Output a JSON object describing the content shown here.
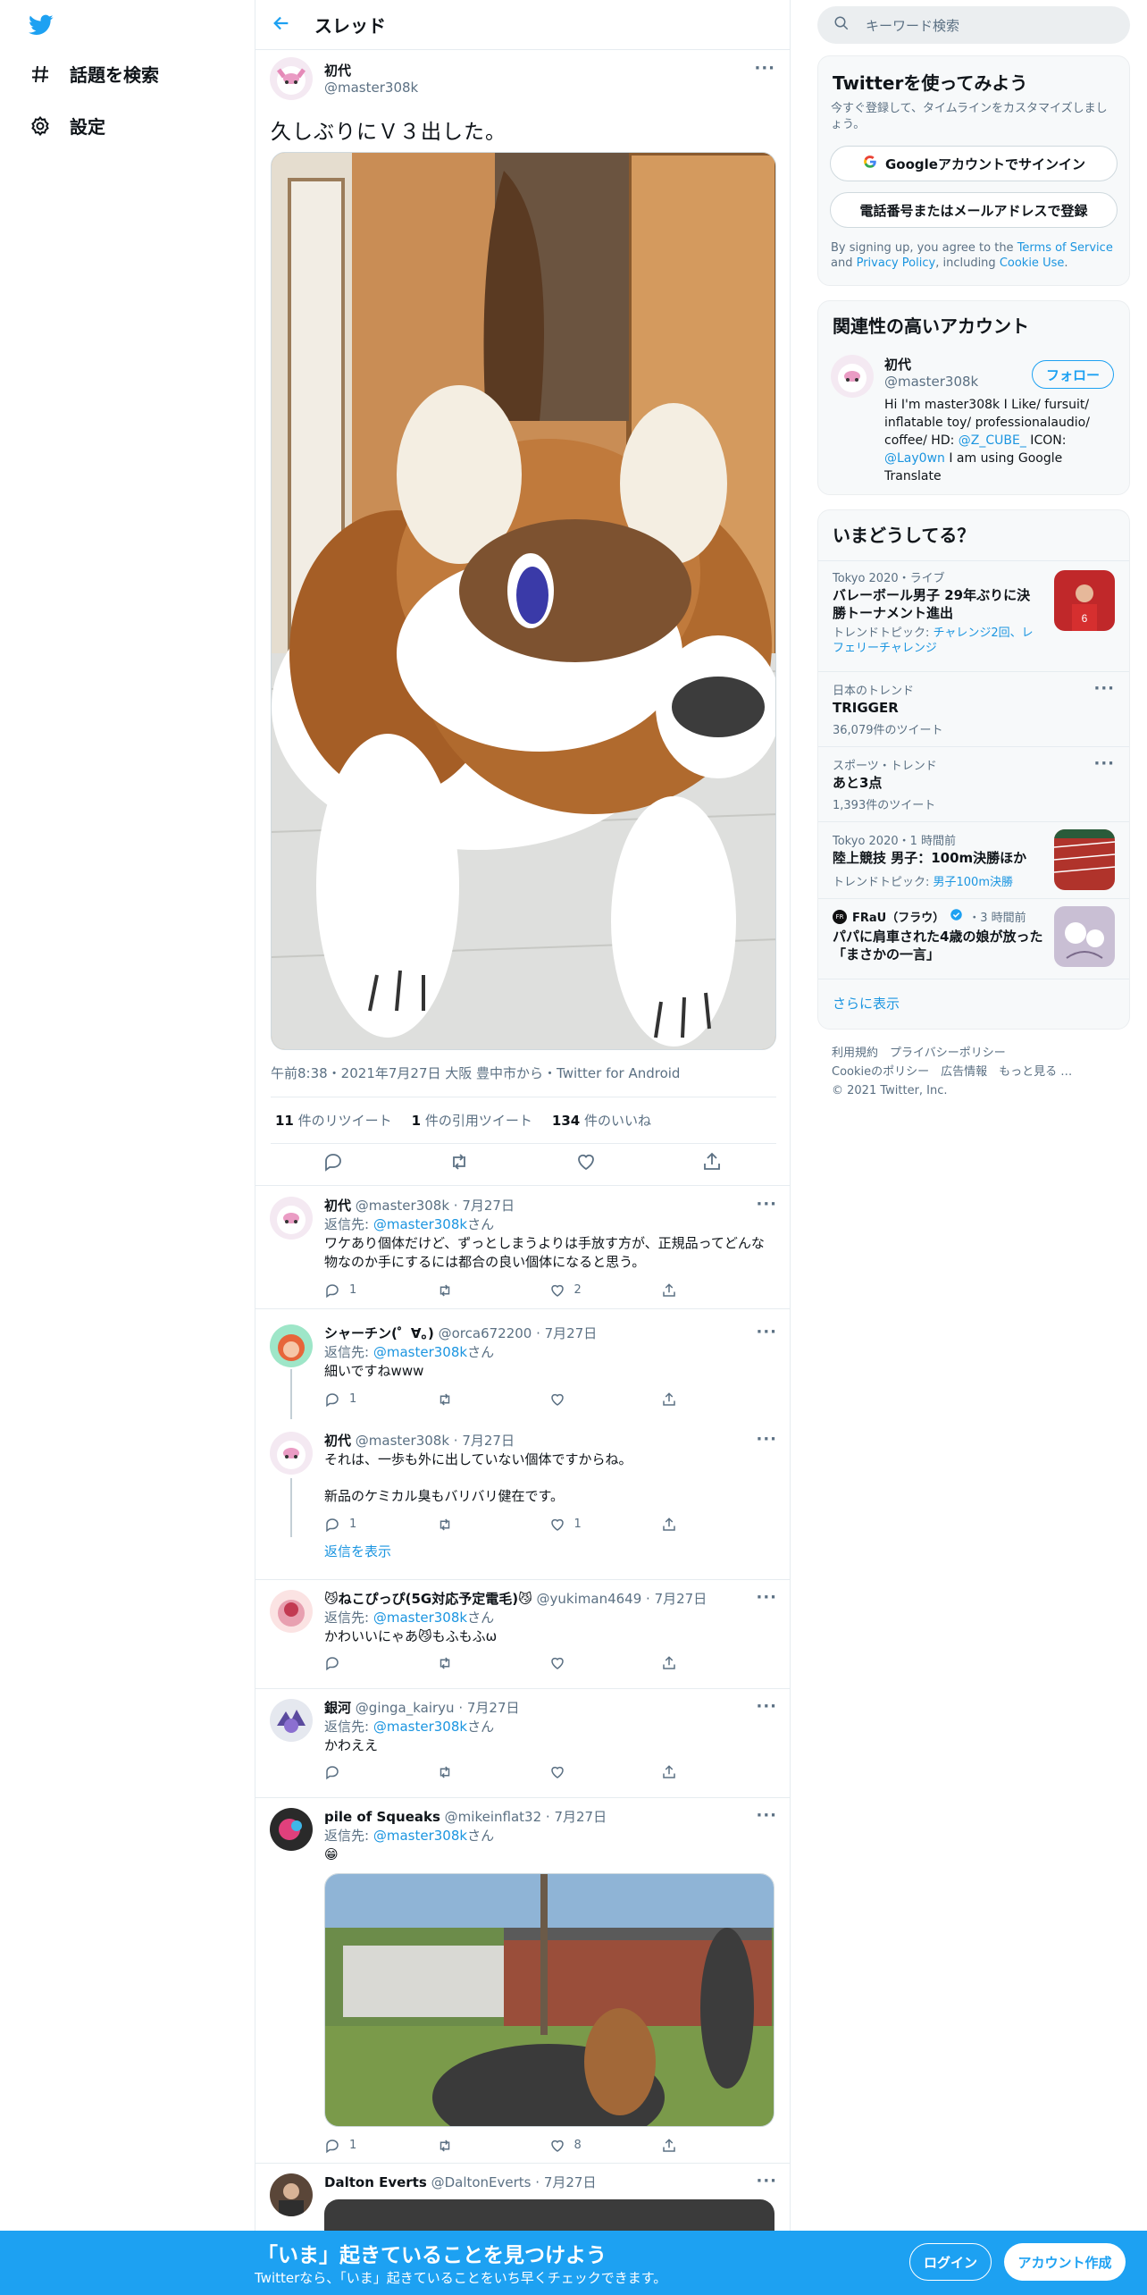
{
  "nav": {
    "logo": "twitter-bird-icon",
    "explore": "話題を検索",
    "settings": "設定"
  },
  "thread": {
    "back_icon": "arrow-left-icon",
    "title": "スレッド",
    "main": {
      "name": "初代",
      "handle": "@master308k",
      "text": "久しぶりにＶ３出した。",
      "meta": "午前8:38・2021年7月27日 大阪 豊中市から・Twitter for Android",
      "retweets_num": "11",
      "retweets_label": "件のリツイート",
      "quotes_num": "1",
      "quotes_label": "件の引用ツイート",
      "likes_num": "134",
      "likes_label": "件のいいね"
    },
    "replies": [
      {
        "name": "初代",
        "handle": "@master308k",
        "date": "7月27日",
        "replying": "返信先:",
        "replying_to": "@master308k",
        "san": "さん",
        "text": "ワケあり個体だけど、ずっとしまうよりは手放す方が、正規品ってどんな物なのか手にするには都合の良い個体になると思う。",
        "reply_count": "1",
        "rt_count": "",
        "like_count": "2"
      },
      {
        "name": "シャーチン(゜∀。)",
        "handle": "@orca672200",
        "date": "7月27日",
        "replying": "返信先:",
        "replying_to": "@master308k",
        "san": "さん",
        "text": "細いですねwww",
        "reply_count": "1",
        "rt_count": "",
        "like_count": ""
      },
      {
        "name": "初代",
        "handle": "@master308k",
        "date": "7月27日",
        "text": "それは、一歩も外に出していない個体ですからね。",
        "text2": "新品のケミカル臭もバリバリ健在です。",
        "reply_count": "1",
        "rt_count": "",
        "like_count": "1",
        "show_replies": "返信を表示"
      },
      {
        "name": "😼ねこぴっぴ(5G対応予定電毛)😼",
        "handle": "@yukiman4649",
        "date": "7月27日",
        "replying": "返信先:",
        "replying_to": "@master308k",
        "san": "さん",
        "text": "かわいいにゃあ😼もふもふω",
        "reply_count": "",
        "rt_count": "",
        "like_count": ""
      },
      {
        "name": "銀河",
        "handle": "@ginga_kairyu",
        "date": "7月27日",
        "replying": "返信先:",
        "replying_to": "@master308k",
        "san": "さん",
        "text": "かわええ",
        "reply_count": "",
        "rt_count": "",
        "like_count": ""
      },
      {
        "name": "pile of Squeaks",
        "handle": "@mikeinflat32",
        "date": "7月27日",
        "replying": "返信先:",
        "replying_to": "@master308k",
        "san": "さん",
        "text": "😁",
        "reply_count": "1",
        "rt_count": "",
        "like_count": "8"
      },
      {
        "name": "Dalton Everts",
        "handle": "@DaltonEverts",
        "date": "7月27日"
      }
    ]
  },
  "right": {
    "search_placeholder": "キーワード検索",
    "signup": {
      "title": "Twitterを使ってみよう",
      "subtitle": "今すぐ登録して、タイムラインをカスタマイズしましょう。",
      "google_btn": "Googleアカウントでサインイン",
      "phone_btn": "電話番号またはメールアドレスで登録",
      "legal_1": "By signing up, you agree to the ",
      "tos": "Terms of Service",
      "legal_2": " and ",
      "privacy": "Privacy Policy",
      "legal_3": ", including ",
      "cookie": "Cookie Use",
      "legal_4": "."
    },
    "related": {
      "title": "関連性の高いアカウント",
      "name": "初代",
      "handle": "@master308k",
      "follow": "フォロー",
      "bio_1": "Hi I'm master308k I Like/ fursuit/ inflatable toy/ professionalaudio/ coffee/ HD: ",
      "bio_link1": "@Z_CUBE_",
      "bio_2": " ICON: ",
      "bio_link2": "@Lay0wn",
      "bio_3": " I am using Google Translate"
    },
    "trends": {
      "title": "いまどうしてる？",
      "items": [
        {
          "context": "Tokyo 2020・ライブ",
          "title": "バレーボール男子 29年ぶりに決勝トーナメント進出",
          "sub_label": "トレンドトピック: ",
          "sub_link": "チャレンジ2回、レフェリーチャレンジ"
        },
        {
          "context": "日本のトレンド",
          "title": "TRIGGER",
          "count": "36,079件のツイート"
        },
        {
          "context": "スポーツ・トレンド",
          "title": "あと3点",
          "count": "1,393件のツイート"
        },
        {
          "context": "Tokyo 2020・1 時間前",
          "title": "陸上競技 男子：100m決勝ほか",
          "sub_label": "トレンドトピック: ",
          "sub_link": "男子100m決勝"
        },
        {
          "account": "FRaU（フラウ）",
          "time": "・3 時間前",
          "title": "パパに肩車された4歳の娘が放った「まさかの一言」"
        }
      ],
      "show_more": "さらに表示"
    },
    "footer": {
      "l1": "利用規約",
      "l2": "プライバシーポリシー",
      "l3": "Cookieのポリシー",
      "l4": "広告情報",
      "l5": "もっと見る …",
      "copy": "© 2021 Twitter, Inc."
    }
  },
  "bottom": {
    "headline": "「いま」起きていることを見つけよう",
    "sub": "Twitterなら、「いま」起きていることをいち早くチェックできます。",
    "login": "ログイン",
    "signup": "アカウント作成"
  },
  "colors": {
    "accent": "#1da1f2",
    "link": "#1b95e0",
    "muted": "#5b7083"
  }
}
